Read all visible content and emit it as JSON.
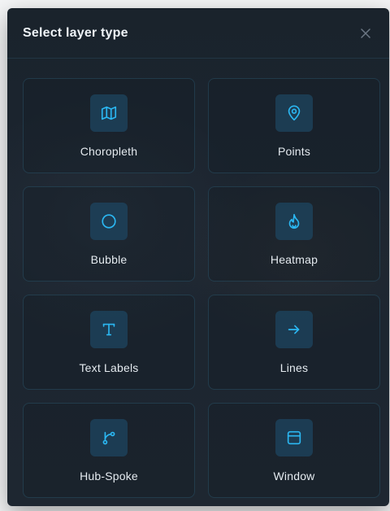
{
  "dialog": {
    "title": "Select layer type",
    "close_icon": "close-icon"
  },
  "layer_types": [
    {
      "label": "Choropleth",
      "icon": "map-icon"
    },
    {
      "label": "Points",
      "icon": "map-pin-icon"
    },
    {
      "label": "Bubble",
      "icon": "circle-icon"
    },
    {
      "label": "Heatmap",
      "icon": "flame-icon"
    },
    {
      "label": "Text Labels",
      "icon": "text-icon"
    },
    {
      "label": "Lines",
      "icon": "arrow-right-icon"
    },
    {
      "label": "Hub-Spoke",
      "icon": "hub-spoke-icon"
    },
    {
      "label": "Window",
      "icon": "window-icon"
    }
  ],
  "colors": {
    "accent": "#2bb7f2",
    "panel": "#1c2530",
    "icon_bg": "#1e4660"
  }
}
